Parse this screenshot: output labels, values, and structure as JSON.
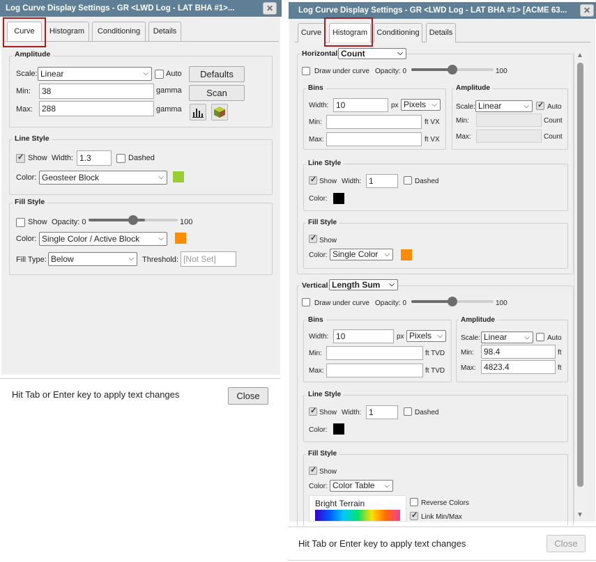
{
  "left": {
    "title": "Log Curve Display Settings - GR <LWD Log - LAT BHA #1>...",
    "tabs": [
      "Curve",
      "Histogram",
      "Conditioning",
      "Details"
    ],
    "amplitude": {
      "title": "Amplitude",
      "scale_label": "Scale:",
      "scale_value": "Linear",
      "auto_label": "Auto",
      "min_label": "Min:",
      "min_value": "38",
      "max_label": "Max:",
      "max_value": "288",
      "unit": "gamma",
      "defaults_button": "Defaults",
      "scan_button": "Scan"
    },
    "line_style": {
      "title": "Line Style",
      "show_label": "Show",
      "width_label": "Width:",
      "width_value": "1.3",
      "dashed_label": "Dashed",
      "color_label": "Color:",
      "color_value": "Geosteer Block",
      "swatch": "#9acd32"
    },
    "fill_style": {
      "title": "Fill Style",
      "show_label": "Show",
      "opacity_label": "Opacity: 0",
      "opacity_max": "100",
      "opacity_fraction": 0.63,
      "color_label": "Color:",
      "color_value": "Single Color / Active Block",
      "swatch": "#ff8c00",
      "fill_type_label": "Fill Type:",
      "fill_type_value": "Below",
      "threshold_label": "Threshold:",
      "threshold_placeholder": "[Not Set]"
    },
    "footer_text": "Hit Tab or Enter key to apply text changes",
    "close_button": "Close"
  },
  "right": {
    "title": "Log Curve Display Settings - GR <LWD Log - LAT BHA #1> [ACME 63...",
    "tabs": [
      "Curve",
      "Histogram",
      "Conditioning",
      "Details"
    ],
    "horizontal": {
      "title": "Horizontal",
      "mode": "Count",
      "draw_under_label": "Draw under curve",
      "opacity_label": "Opacity: 0",
      "opacity_max": "100",
      "opacity_fraction": 0.5,
      "bins": {
        "title": "Bins",
        "width_label": "Width:",
        "width_value": "10",
        "px_label": "px",
        "units_value": "Pixels",
        "min_label": "Min:",
        "max_label": "Max:",
        "unit": "ft VX"
      },
      "amplitude": {
        "title": "Amplitude",
        "scale_label": "Scale:",
        "scale_value": "Linear",
        "auto_label": "Auto",
        "min_label": "Min:",
        "max_label": "Max:",
        "unit": "Count"
      },
      "line_style": {
        "title": "Line Style",
        "show_label": "Show",
        "width_label": "Width:",
        "width_value": "1",
        "dashed_label": "Dashed",
        "color_label": "Color:",
        "swatch": "#000000"
      },
      "fill_style": {
        "title": "Fill Style",
        "show_label": "Show",
        "color_label": "Color:",
        "color_value": "Single Color",
        "swatch": "#ff8c00"
      }
    },
    "vertical": {
      "title": "Vertical",
      "mode": "Length Sum",
      "draw_under_label": "Draw under curve",
      "opacity_label": "Opacity: 0",
      "opacity_max": "100",
      "opacity_fraction": 0.5,
      "bins": {
        "title": "Bins",
        "width_label": "Width:",
        "width_value": "10",
        "px_label": "px",
        "units_value": "Pixels",
        "min_label": "Min:",
        "max_label": "Max:",
        "unit": "ft TVD"
      },
      "amplitude": {
        "title": "Amplitude",
        "scale_label": "Scale:",
        "scale_value": "Linear",
        "auto_label": "Auto",
        "min_label": "Min:",
        "min_value": "98.4",
        "max_label": "Max:",
        "max_value": "4823.4",
        "unit": "ft"
      },
      "line_style": {
        "title": "Line Style",
        "show_label": "Show",
        "width_label": "Width:",
        "width_value": "1",
        "dashed_label": "Dashed",
        "color_label": "Color:",
        "swatch": "#000000"
      },
      "fill_style": {
        "title": "Fill Style",
        "show_label": "Show",
        "color_label": "Color:",
        "color_value": "Color Table",
        "color_table_name": "Bright Terrain",
        "reverse_label": "Reverse Colors",
        "link_label": "Link Min/Max"
      }
    },
    "footer_text": "Hit Tab or Enter key to apply text changes",
    "close_button": "Close"
  }
}
